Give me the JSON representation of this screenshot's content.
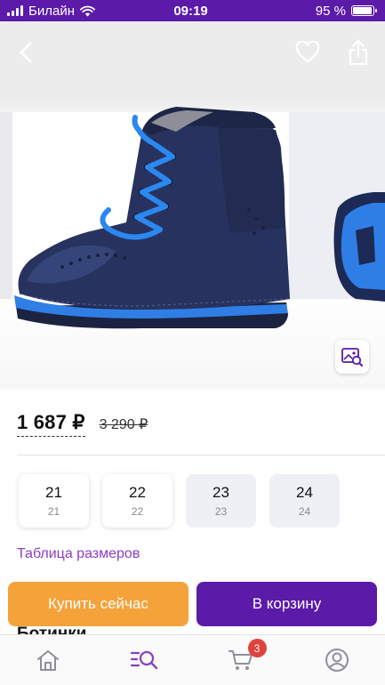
{
  "status_bar": {
    "carrier": "Билайн",
    "time": "09:19",
    "battery_text": "95 %",
    "battery_level": 0.95
  },
  "colors": {
    "brand": "#5b1aa8",
    "buy_button": "#f3a33a",
    "link": "#8a3ec2",
    "badge": "#e0433c"
  },
  "gallery": {
    "icons": {
      "back": "chevron-left-icon",
      "favorite": "heart-icon",
      "share": "share-icon",
      "zoom": "image-search-icon"
    }
  },
  "product": {
    "price": "1 687 ₽",
    "old_price": "3 290 ₽",
    "title": "Ботинки"
  },
  "sizes": [
    {
      "main": "21",
      "sub": "21",
      "state": "available"
    },
    {
      "main": "22",
      "sub": "22",
      "state": "available"
    },
    {
      "main": "23",
      "sub": "23",
      "state": "muted"
    },
    {
      "main": "24",
      "sub": "24",
      "state": "muted"
    }
  ],
  "size_table_link": "Таблица размеров",
  "actions": {
    "buy_now": "Купить сейчас",
    "add_to_cart": "В корзину"
  },
  "bottom_nav": {
    "items": [
      {
        "icon": "home-icon",
        "active": false
      },
      {
        "icon": "catalog-search-icon",
        "active": true
      },
      {
        "icon": "cart-icon",
        "active": false,
        "badge": "3"
      },
      {
        "icon": "profile-icon",
        "active": false
      }
    ]
  }
}
